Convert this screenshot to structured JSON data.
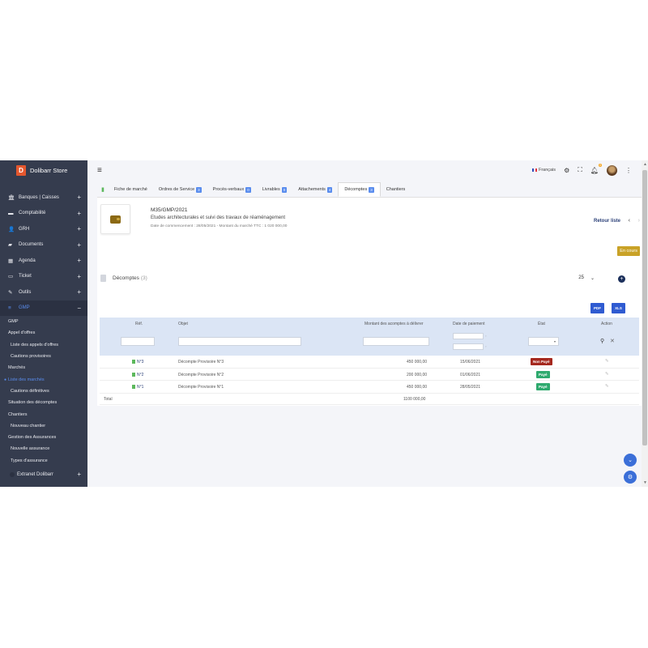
{
  "app": {
    "brand_letter": "D",
    "brand_name": "Dolibarr Store"
  },
  "sidebar": {
    "items": [
      {
        "label": "Banques | Caisses",
        "icon": "bank-icon",
        "glyph": "🏛"
      },
      {
        "label": "Comptabilité",
        "icon": "money-icon",
        "glyph": "▬"
      },
      {
        "label": "GRH",
        "icon": "user-icon",
        "glyph": "👤"
      },
      {
        "label": "Documents",
        "icon": "folder-icon",
        "glyph": "▰"
      },
      {
        "label": "Agenda",
        "icon": "calendar-icon",
        "glyph": "▦"
      },
      {
        "label": "Ticket",
        "icon": "ticket-icon",
        "glyph": "▭"
      },
      {
        "label": "Outils",
        "icon": "wrench-icon",
        "glyph": "✎"
      },
      {
        "label": "GMP",
        "icon": "list-icon",
        "glyph": "≡",
        "active": true
      }
    ],
    "submenu": [
      {
        "label": "GMP",
        "level": 1
      },
      {
        "label": "Appel d'offres",
        "level": 1
      },
      {
        "label": "Liste des appels d'offres",
        "level": 2
      },
      {
        "label": "Cautions provisoires",
        "level": 2
      },
      {
        "label": "Marchés",
        "level": 1
      },
      {
        "label": "Liste des marchés",
        "level": 1,
        "current": true
      },
      {
        "label": "Cautions définitives",
        "level": 2
      },
      {
        "label": "Situation des décomptes",
        "level": 1
      },
      {
        "label": "Chantiers",
        "level": 1
      },
      {
        "label": "Nouveau chantier",
        "level": 2
      },
      {
        "label": "Gestion des Assurances",
        "level": 1
      },
      {
        "label": "Nouvelle assurance",
        "level": 2
      },
      {
        "label": "Types d'assurance",
        "level": 2
      }
    ],
    "extranet": "Extranet Dolibarr"
  },
  "topbar": {
    "language": "Français",
    "notif_count": "0"
  },
  "tabs": [
    {
      "label": "Fiche de marché",
      "count": ""
    },
    {
      "label": "Ordres de Service",
      "count": "3"
    },
    {
      "label": "Procès-verbaux",
      "count": "0"
    },
    {
      "label": "Livrables",
      "count": "0"
    },
    {
      "label": "Attachements",
      "count": "4"
    },
    {
      "label": "Décomptes",
      "count": "3",
      "active": true
    },
    {
      "label": "Chantiers",
      "count": ""
    }
  ],
  "marche": {
    "ref": "M35/GMP/2021",
    "description": "Etudes architecturales et suivi des travaux de réaménagement",
    "meta": "Date de commencement : 28/05/2021 - Montant du marché TTC : 1 020 000,00",
    "back_label": "Retour liste",
    "status": "En cours"
  },
  "decomptes": {
    "title": "Décomptes",
    "count": "(3)",
    "per_page": "25",
    "pdf_label": "PDF",
    "xls_label": "XLS",
    "columns": {
      "ref": "Réf.",
      "objet": "Objet",
      "montant": "Montant des acomptes à délivrer",
      "date": "Date de paiement",
      "etat": "État",
      "action": "Action"
    },
    "rows": [
      {
        "ref": "N°3",
        "objet": "Décompte Provisoire N°3",
        "montant": "450 000,00",
        "date": "15/06/2021",
        "etat": "Non Payé",
        "paid": false
      },
      {
        "ref": "N°2",
        "objet": "Décompte Provisoire N°2",
        "montant": "200 000,00",
        "date": "01/06/2021",
        "etat": "Payé",
        "paid": true
      },
      {
        "ref": "N°1",
        "objet": "Décompte Provisoire N°1",
        "montant": "450 000,00",
        "date": "28/05/2021",
        "etat": "Payé",
        "paid": true
      }
    ],
    "total_label": "Total",
    "total_value": "1100 000,00"
  },
  "colors": {
    "sidebar": "#353c4e",
    "accent": "#5a8dee",
    "header_row": "#dbe5f5",
    "non_paye": "#a5281e",
    "paye": "#2eaa6e",
    "status": "#c9a227"
  }
}
